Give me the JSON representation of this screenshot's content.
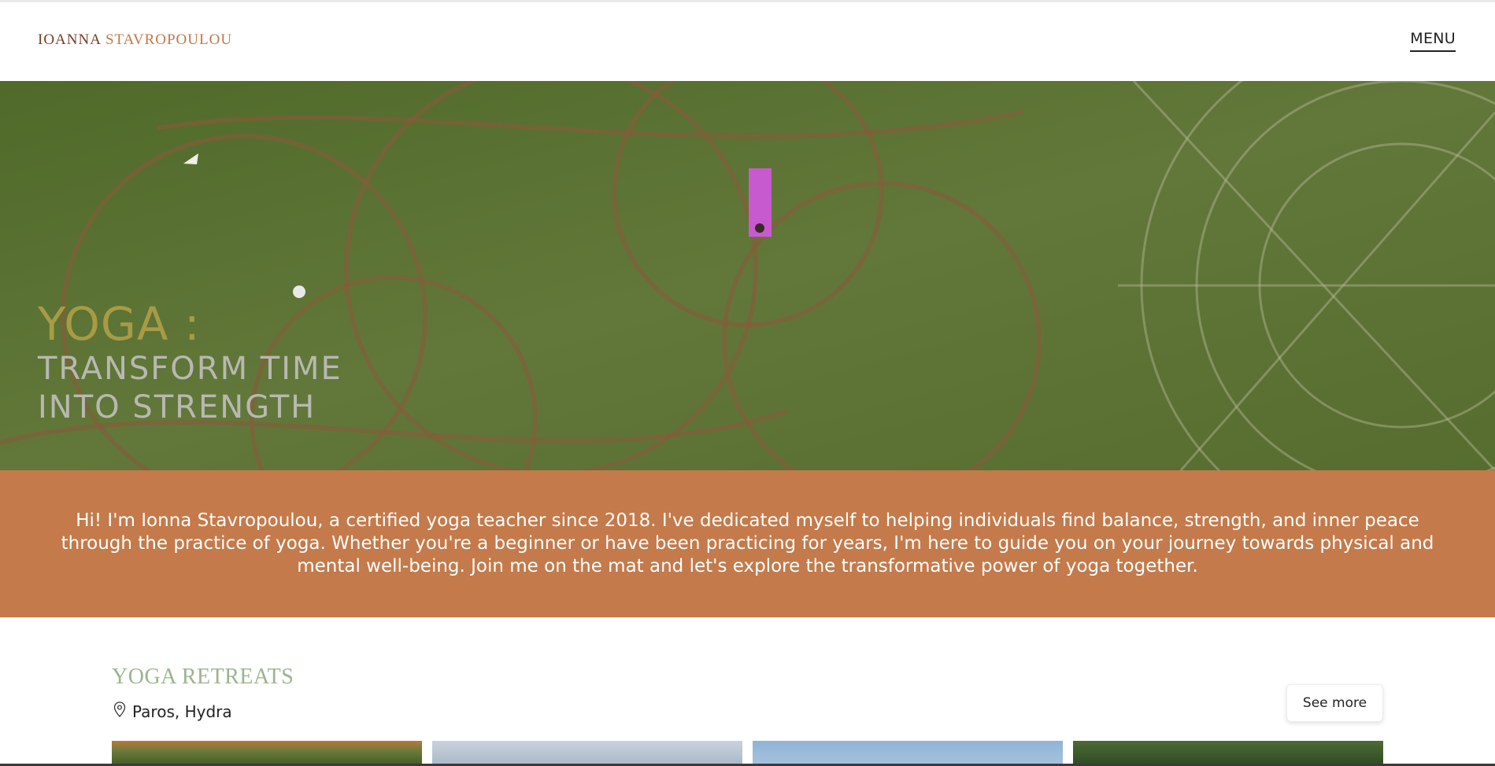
{
  "brand": {
    "first": "IOANNA",
    "last": "STAVROPOULOU"
  },
  "nav": {
    "menu_label": "MENU"
  },
  "hero": {
    "line1": "YOGA :",
    "line2": "TRANSFORM TIME",
    "line3": "INTO STRENGTH"
  },
  "intro": {
    "text": "Hi! I'm Ionna Stavropoulou, a certified yoga teacher since 2018. I've dedicated myself to helping individuals find balance, strength, and inner peace through the practice of yoga. Whether you're a beginner or have been practicing for years, I'm here to guide you on your journey towards physical and mental well-being. Join me on the mat and let's explore the transformative power of yoga together."
  },
  "retreats": {
    "heading": "YOGA RETREATS",
    "location": "Paros, Hydra",
    "location_icon": "map-pin-icon",
    "see_more_label": "See more"
  },
  "colors": {
    "accent": "#c47a4a",
    "brand_dark": "#7a3a23",
    "brand_light": "#c27747",
    "heading_green": "#9ab58d",
    "hero_gold": "#a79b45"
  }
}
